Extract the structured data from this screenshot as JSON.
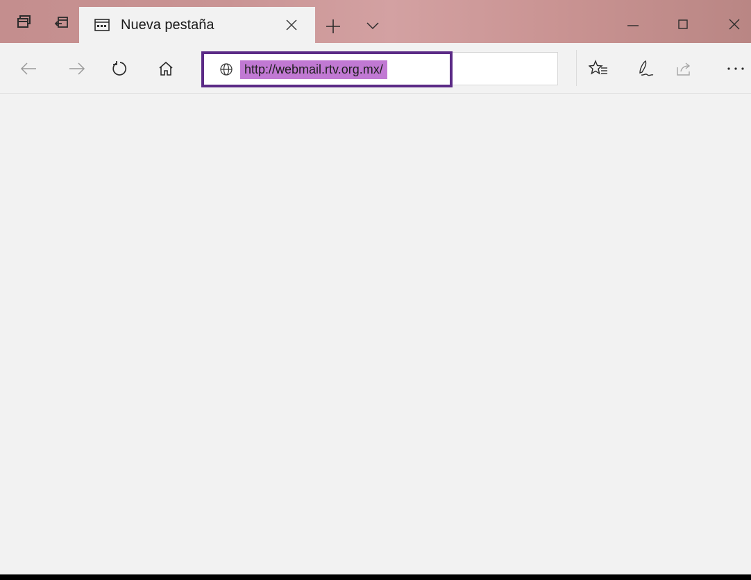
{
  "tab": {
    "title": "Nueva pestaña"
  },
  "address_bar": {
    "url": "http://webmail.rtv.org.mx/"
  },
  "colors": {
    "titlebar_accent": "#c99494",
    "address_highlight": "#c179d3",
    "focus_outline": "#5b2a86"
  },
  "icons": {
    "titlebar": [
      "tabs-aside-icon",
      "tab-restore-icon",
      "page-icon",
      "close-icon",
      "plus-icon",
      "chevron-down-icon"
    ],
    "window": [
      "minimize-icon",
      "maximize-icon",
      "close-icon"
    ],
    "navigation": [
      "back-arrow-icon",
      "forward-arrow-icon",
      "refresh-icon",
      "home-icon",
      "globe-icon"
    ],
    "toolbar": [
      "favorites-star-icon",
      "pen-icon",
      "share-icon",
      "more-dots-icon"
    ]
  }
}
